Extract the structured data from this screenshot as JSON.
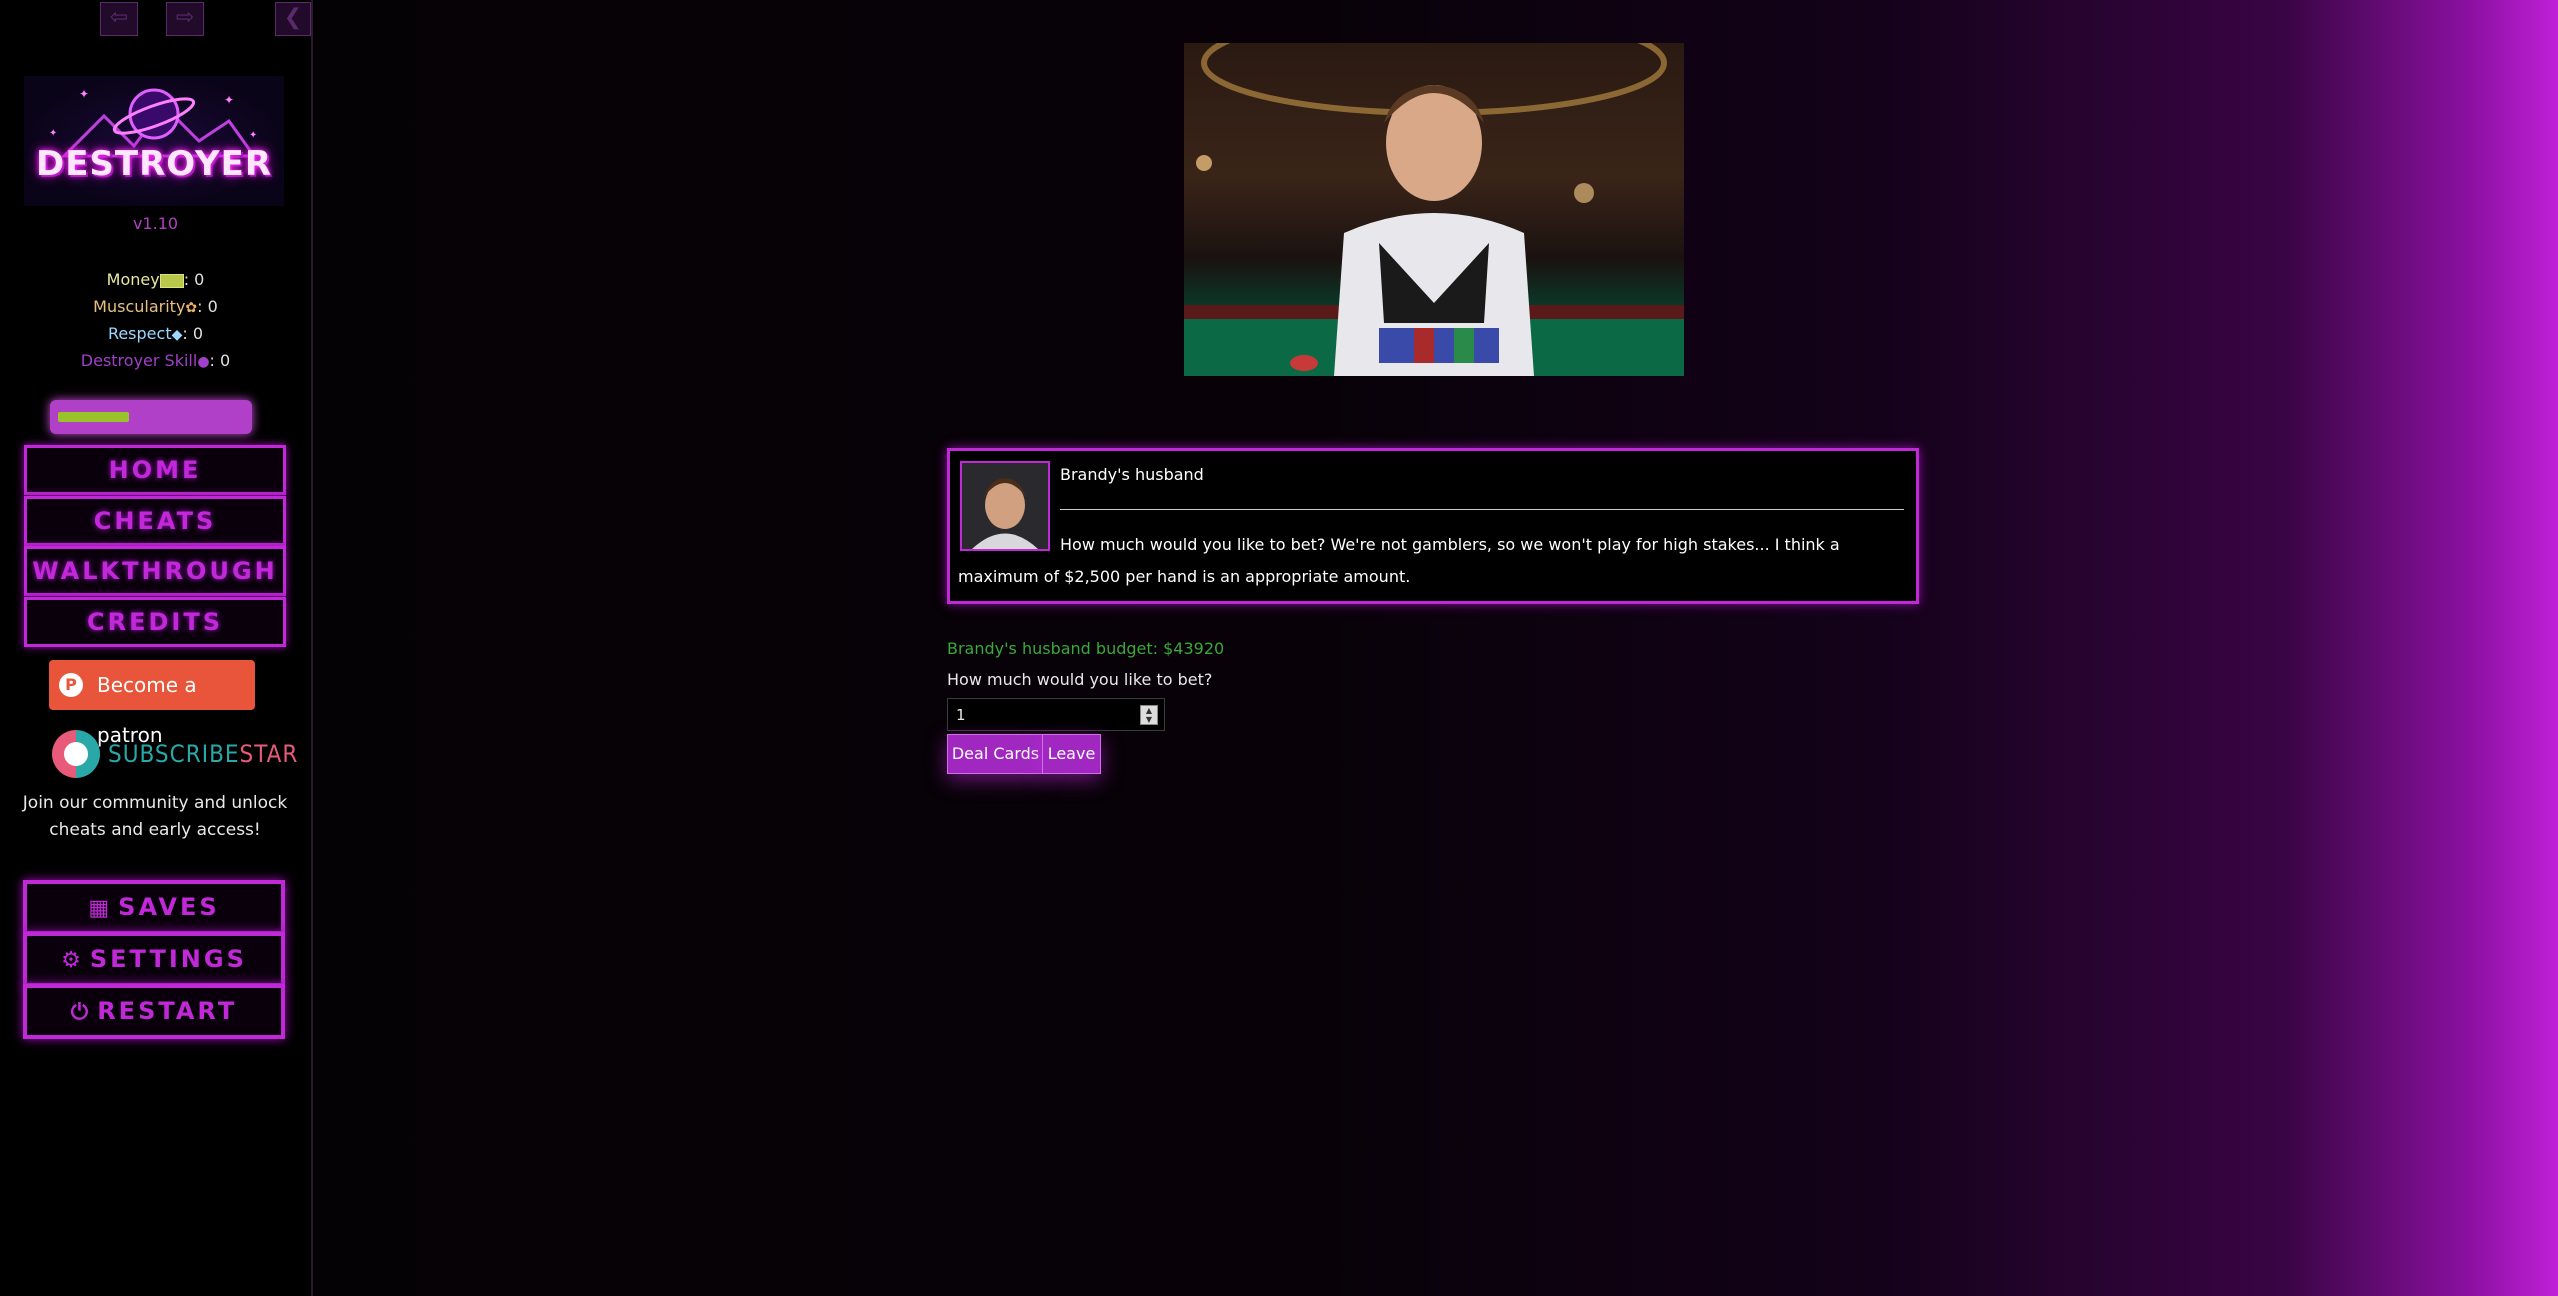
{
  "sidebar": {
    "history": {
      "back_icon": "arrow-left-icon",
      "forward_icon": "arrow-right-icon",
      "collapse_icon": "chevron-left-icon"
    },
    "logo_text": "DESTROYER",
    "version": "v1.10",
    "stats": [
      {
        "label": "Money",
        "icon": "cash-icon",
        "value": "0"
      },
      {
        "label": "Muscularity",
        "icon": "flexed-arm-icon",
        "value": "0"
      },
      {
        "label": "Respect",
        "icon": "gem-icon",
        "value": "0"
      },
      {
        "label": "Destroyer Skill",
        "icon": "destroyer-skill-icon",
        "value": "0"
      }
    ],
    "progress_fraction": 0.38,
    "nav": [
      "HOME",
      "CHEATS",
      "WALKTHROUGH",
      "CREDITS"
    ],
    "patron_label": "Become a patron",
    "subscribestar": {
      "sub": "SUBSCRIBE",
      "star": "STAR"
    },
    "community_text": "Join our community and unlock cheats and early access!",
    "menu": [
      {
        "label": "SAVES",
        "icon": "floppy-disk-icon"
      },
      {
        "label": "SETTINGS",
        "icon": "gear-icon"
      },
      {
        "label": "RESTART",
        "icon": "power-icon"
      }
    ]
  },
  "main": {
    "dialog": {
      "speaker": "Brandy's husband",
      "text": "How much would you like to bet? We're not gamblers, so we won't play for high stakes... I think a maximum of $2,500 per hand is an appropriate amount."
    },
    "budget_text": "Brandy's husband budget: $43920",
    "bet_question": "How much would you like to bet?",
    "bet_value": "1",
    "buttons": {
      "deal": "Deal Cards",
      "leave": "Leave"
    }
  },
  "colors": {
    "accent": "#c028d8",
    "budget_green": "#3aa83a",
    "patron_orange": "#e8553a",
    "progress_fill": "#9ac22a"
  }
}
